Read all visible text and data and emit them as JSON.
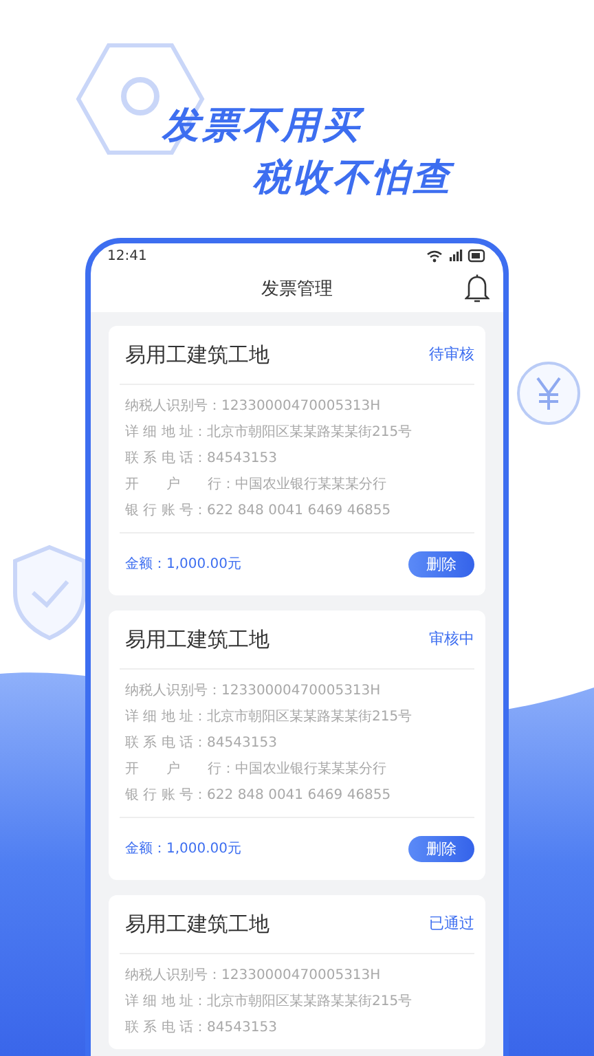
{
  "slogan": [
    "发票不用买",
    "税收不怕查"
  ],
  "status_bar": {
    "time": "12:41"
  },
  "header": {
    "title": "发票管理"
  },
  "cards": [
    {
      "title": "易用工建筑工地",
      "status": "待审核",
      "rows": [
        {
          "label": "纳税人识别号：",
          "value": "12330000470005313H"
        },
        {
          "label": "详 细 地 址：",
          "value": "北京市朝阳区某某路某某街215号"
        },
        {
          "label": "联 系 电 话：",
          "value": "84543153"
        },
        {
          "label": "开　　户　　行：",
          "value": "中国农业银行某某某分行"
        },
        {
          "label": "银 行 账 号：",
          "value": "622 848 0041 6469 46855"
        }
      ],
      "amount": "金额：1,000.00元",
      "delete": "删除"
    },
    {
      "title": "易用工建筑工地",
      "status": "审核中",
      "rows": [
        {
          "label": "纳税人识别号：",
          "value": "12330000470005313H"
        },
        {
          "label": "详 细 地 址：",
          "value": "北京市朝阳区某某路某某街215号"
        },
        {
          "label": "联 系 电 话：",
          "value": "84543153"
        },
        {
          "label": "开　　户　　行：",
          "value": "中国农业银行某某某分行"
        },
        {
          "label": "银 行 账 号：",
          "value": "622 848 0041 6469 46855"
        }
      ],
      "amount": "金额：1,000.00元",
      "delete": "删除"
    },
    {
      "title": "易用工建筑工地",
      "status": "已通过",
      "rows": [
        {
          "label": "纳税人识别号：",
          "value": "12330000470005313H"
        },
        {
          "label": "详 细 地 址：",
          "value": "北京市朝阳区某某路某某街215号"
        },
        {
          "label": "联 系 电 话：",
          "value": "84543153"
        }
      ]
    }
  ]
}
